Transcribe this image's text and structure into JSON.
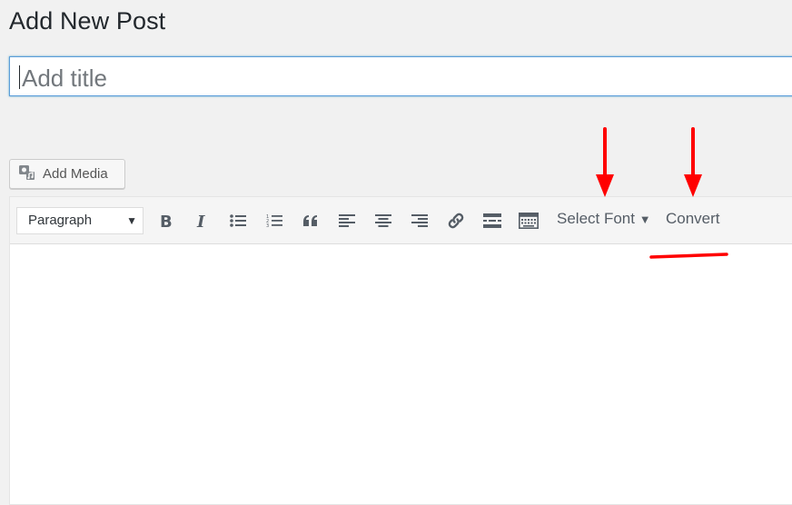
{
  "page": {
    "title": "Add New Post"
  },
  "title_field": {
    "placeholder": "Add title"
  },
  "media": {
    "label": "Add Media",
    "icon": "media-camera-icon"
  },
  "toolbar": {
    "format_select": {
      "value": "Paragraph"
    },
    "buttons": [
      {
        "name": "bold",
        "icon": "bold-icon"
      },
      {
        "name": "italic",
        "icon": "italic-icon"
      },
      {
        "name": "bulleted-list",
        "icon": "bulleted-list-icon"
      },
      {
        "name": "numbered-list",
        "icon": "numbered-list-icon"
      },
      {
        "name": "blockquote",
        "icon": "blockquote-icon"
      },
      {
        "name": "align-left",
        "icon": "align-left-icon"
      },
      {
        "name": "align-center",
        "icon": "align-center-icon"
      },
      {
        "name": "align-right",
        "icon": "align-right-icon"
      },
      {
        "name": "insert-link",
        "icon": "link-icon"
      },
      {
        "name": "read-more",
        "icon": "read-more-icon"
      },
      {
        "name": "toolbar-toggle",
        "icon": "keyboard-icon"
      }
    ],
    "select_font_label": "Select Font",
    "convert_label": "Convert"
  },
  "annotations": {
    "color": "#ff0000"
  }
}
